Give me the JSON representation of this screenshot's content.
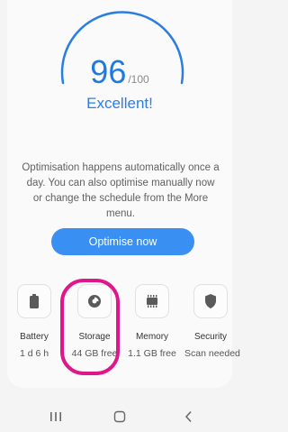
{
  "score": {
    "value": "96",
    "max": "/100",
    "status": "Excellent!",
    "fraction": 0.96,
    "accent_color": "#2a7ee3"
  },
  "description": "Optimisation happens automatically once a day. You can also optimise manually now or change the schedule from the More menu.",
  "optimise_button": "Optimise now",
  "tiles": [
    {
      "label": "Battery",
      "value": "1 d 6 h",
      "icon": "battery-icon"
    },
    {
      "label": "Storage",
      "value": "44 GB free",
      "icon": "storage-pie-icon"
    },
    {
      "label": "Memory",
      "value": "1.1 GB free",
      "icon": "memory-chip-icon"
    },
    {
      "label": "Security",
      "value": "Scan needed",
      "icon": "shield-icon"
    }
  ],
  "highlight_color": "#e0178a",
  "navbar": {
    "recents_icon": "recents-icon",
    "home_icon": "home-icon",
    "back_icon": "back-icon"
  }
}
